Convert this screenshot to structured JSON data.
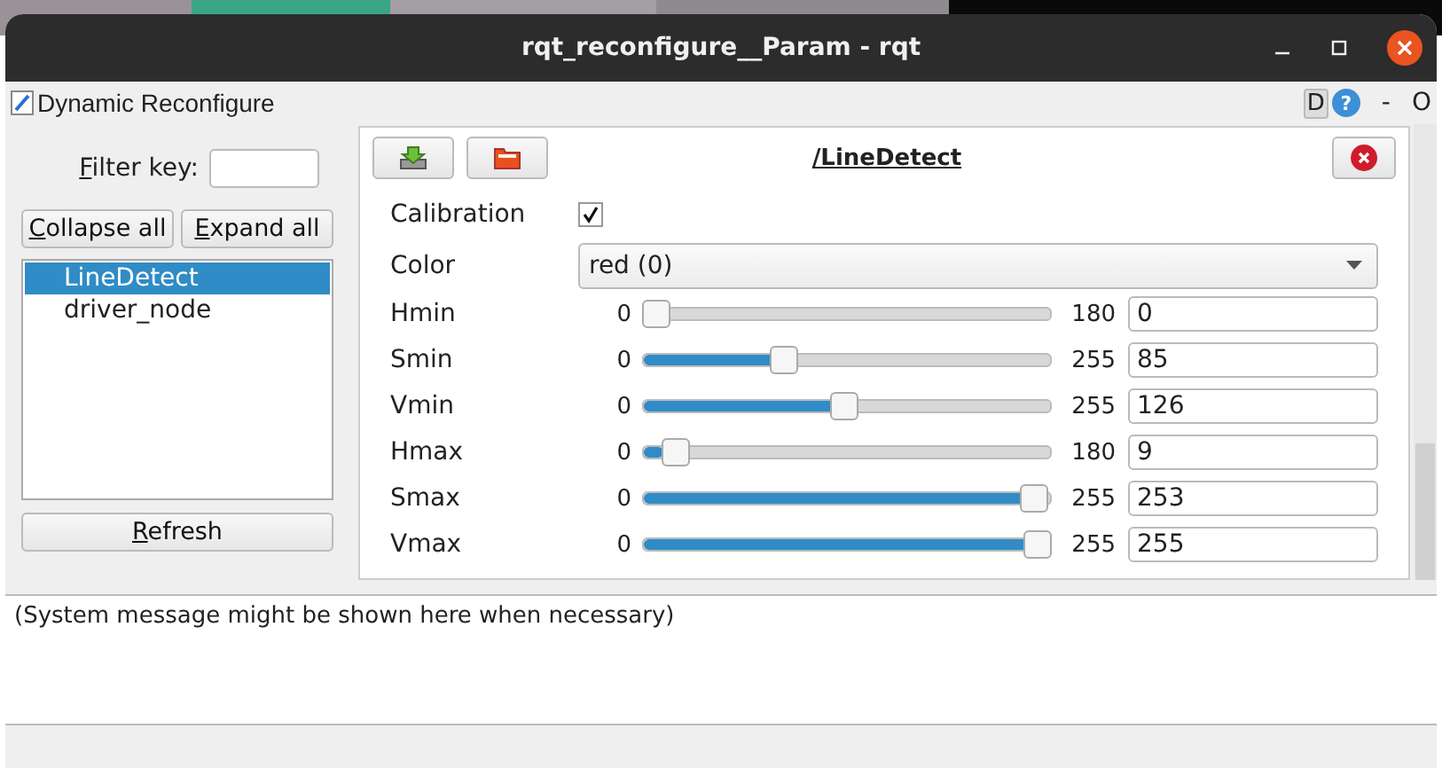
{
  "window": {
    "title": "rqt_reconfigure__Param - rqt"
  },
  "plugin_bar": {
    "title": "Dynamic Reconfigure",
    "help_letter": "D",
    "help_mark": "?",
    "dash": "-",
    "o": "O"
  },
  "left_panel": {
    "filter_label": "Filter key:",
    "collapse_button": "Collapse all",
    "expand_button": "Expand all",
    "nodes": [
      {
        "label": "LineDetect",
        "selected": true
      },
      {
        "label": "driver_node",
        "selected": false
      }
    ],
    "refresh_button": "Refresh"
  },
  "editor": {
    "title": "/LineDetect",
    "params": [
      {
        "kind": "checkbox",
        "name": "Calibration",
        "checked": true
      },
      {
        "kind": "dropdown",
        "name": "Color",
        "value": "red (0)"
      },
      {
        "kind": "slider",
        "name": "Hmin",
        "min": "0",
        "max": "180",
        "level": 0,
        "value": "0"
      },
      {
        "kind": "slider",
        "name": "Smin",
        "min": "0",
        "max": "255",
        "level": 0.333,
        "value": "85"
      },
      {
        "kind": "slider",
        "name": "Vmin",
        "min": "0",
        "max": "255",
        "level": 0.494,
        "value": "126"
      },
      {
        "kind": "slider",
        "name": "Hmax",
        "min": "0",
        "max": "180",
        "level": 0.05,
        "value": "9"
      },
      {
        "kind": "slider",
        "name": "Smax",
        "min": "0",
        "max": "255",
        "level": 0.992,
        "value": "253"
      },
      {
        "kind": "slider",
        "name": "Vmax",
        "min": "0",
        "max": "255",
        "level": 1,
        "value": "255"
      }
    ]
  },
  "message": "(System message might be shown here when necessary)"
}
